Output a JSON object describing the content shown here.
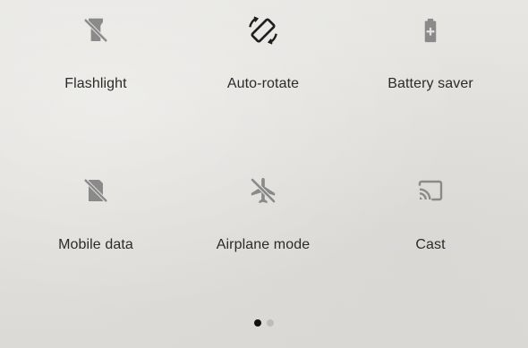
{
  "quick_settings": {
    "tiles": [
      {
        "label": "Flashlight",
        "icon": "flashlight-off-icon",
        "state": "off"
      },
      {
        "label": "Auto-rotate",
        "icon": "auto-rotate-icon",
        "state": "on"
      },
      {
        "label": "Battery saver",
        "icon": "battery-saver-icon",
        "state": "off"
      },
      {
        "label": "Mobile data",
        "icon": "mobile-data-off-icon",
        "state": "off"
      },
      {
        "label": "Airplane mode",
        "icon": "airplane-mode-off-icon",
        "state": "off"
      },
      {
        "label": "Cast",
        "icon": "cast-icon",
        "state": "off"
      }
    ],
    "pages": {
      "current": 1,
      "total": 2
    }
  },
  "colors": {
    "icon_off": "#8a8a8a",
    "icon_on": "#1f1f1f",
    "label": "#2b2b2b",
    "page_dot_active": "#111111",
    "page_dot_inactive": "#bdbdbd"
  }
}
